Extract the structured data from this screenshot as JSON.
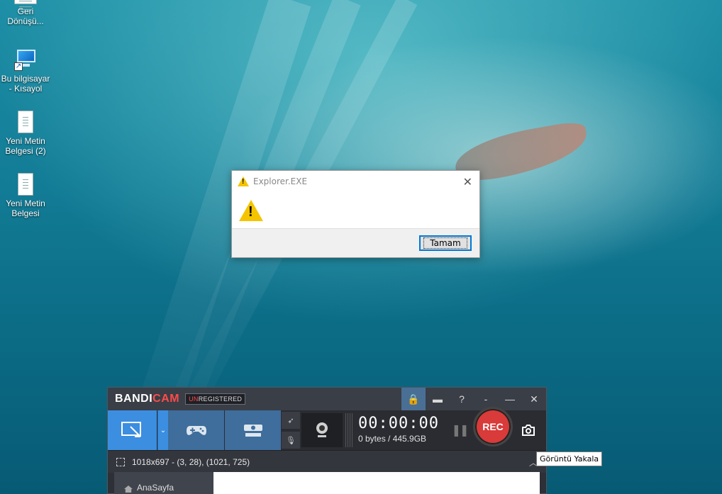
{
  "desktop": {
    "icons": [
      {
        "label_line1": "Geri",
        "label_line2": "Dönüşü..."
      },
      {
        "label_line1": "Bu bilgisayar",
        "label_line2": "- Kısayol"
      },
      {
        "label_line1": "Yeni Metin",
        "label_line2": "Belgesi (2)"
      },
      {
        "label_line1": "Yeni Metin",
        "label_line2": "Belgesi"
      }
    ]
  },
  "dialog": {
    "title": "Explorer.EXE",
    "close_glyph": "✕",
    "ok_label": "Tamam"
  },
  "bandicam": {
    "brand_a": "BANDI",
    "brand_b": "CAM",
    "unreg_a": "UN",
    "unreg_b": "REGISTERED",
    "top_buttons": {
      "lock": "🔒",
      "folder": "▬",
      "help": "?",
      "dash": "-",
      "minimize": "—",
      "close": "✕"
    },
    "dropdown_glyph": "⌄",
    "timer": "00:00:00",
    "size": "0 bytes / 445.9GB",
    "pause_glyph": "❚❚",
    "rec_label": "REC",
    "region_info": "1018x697 - (3, 28), (1021, 725)",
    "chevron": "︿",
    "nav_home": "AnaSayfa"
  },
  "tooltip": {
    "text": "Görüntü Yakala"
  }
}
